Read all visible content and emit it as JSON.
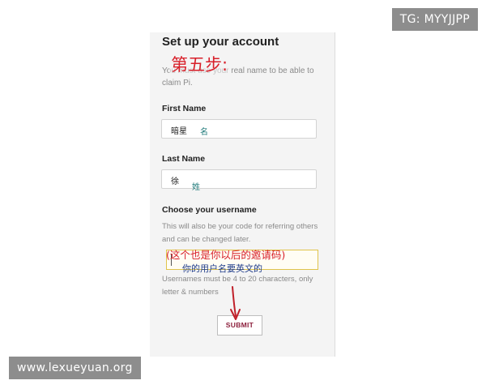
{
  "form": {
    "title": "Set up your account",
    "intro": "You must use your real name to be able to claim Pi.",
    "first_name_label": "First Name",
    "first_name_value": "暗星",
    "last_name_label": "Last Name",
    "last_name_value": "徐",
    "username_label": "Choose your username",
    "username_desc": "This will also be your code for referring others and can be changed later.",
    "username_value": "",
    "username_rules": "Usernames must be 4 to 20 characters, only letter & numbers",
    "submit_label": "SUBMIT"
  },
  "annotations": {
    "step": "第五步:",
    "first_name_note": "名",
    "last_name_note": "姓",
    "invite_note": "(这个也是你以后的邀请码)",
    "username_note": "你的用户名要英文的"
  },
  "watermarks": {
    "tg": "TG: MYYJJPP",
    "site": "www.lexueyuan.org"
  },
  "colors": {
    "annotation_red": "#d8202a",
    "annotation_teal": "#1f7a7a",
    "annotation_blue": "#1f3c8a",
    "submit_text": "#8c1f3c"
  }
}
